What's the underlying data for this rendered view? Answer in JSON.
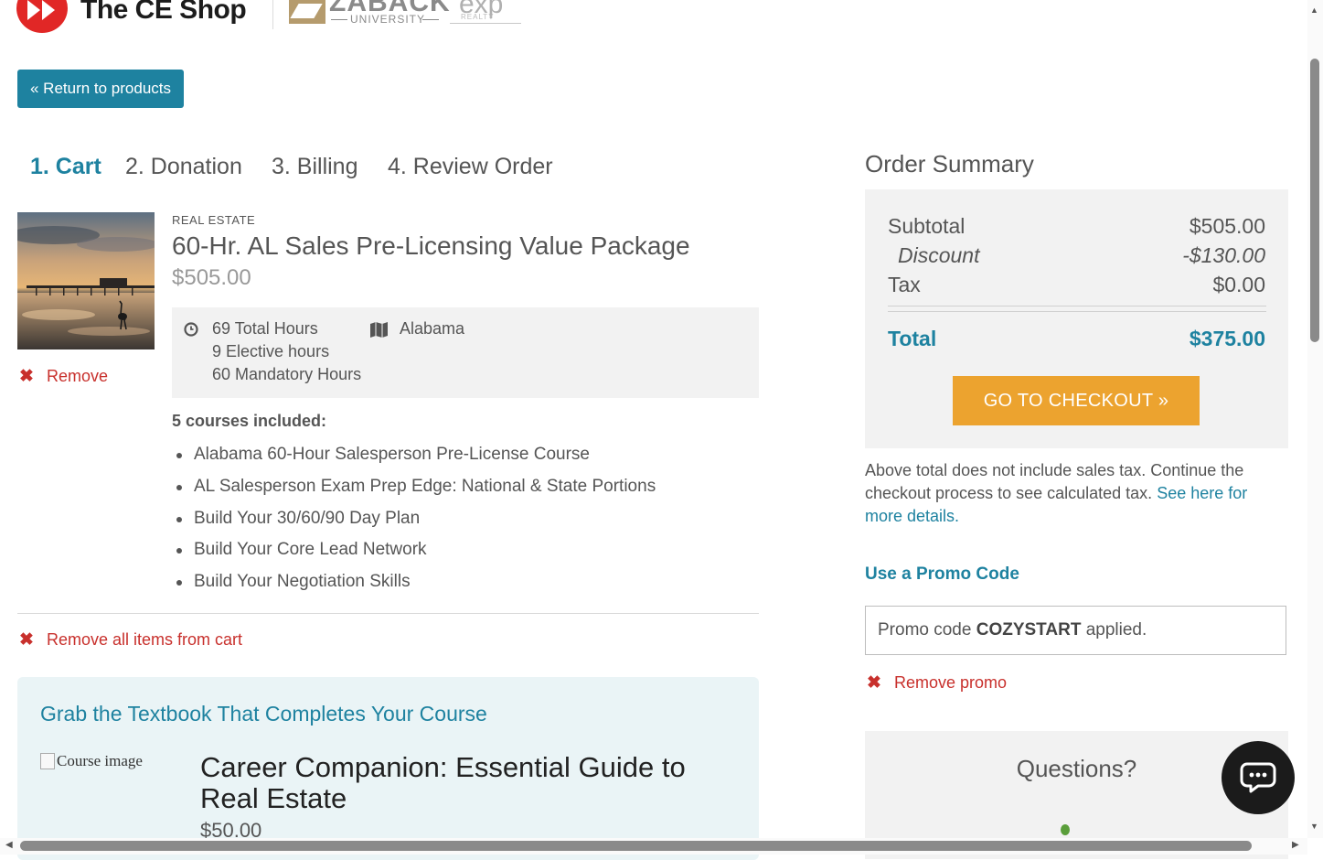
{
  "header": {
    "brand": "The CE Shop",
    "partner1": "ZABACK",
    "partner1_sub": "UNIVERSITY",
    "partner2": "exp",
    "partner2_sub": "REALTY"
  },
  "return_button": "« Return to products",
  "steps": [
    "1. Cart",
    "2. Donation",
    "3. Billing",
    "4. Review Order"
  ],
  "active_step": 0,
  "cart_item": {
    "category": "REAL ESTATE",
    "title": "60-Hr. AL Sales Pre-Licensing Value Package",
    "price": "$505.00",
    "total_hours": "69 Total Hours",
    "elective_hours": "9 Elective hours",
    "mandatory_hours": "60 Mandatory Hours",
    "state": "Alabama",
    "remove_label": "Remove",
    "courses_label": "5 courses included:",
    "courses": [
      "Alabama 60-Hour Salesperson Pre-License Course",
      "AL Salesperson Exam Prep Edge: National & State Portions",
      "Build Your 30/60/90 Day Plan",
      "Build Your Core Lead Network",
      "Build Your Negotiation Skills"
    ]
  },
  "remove_all_label": "Remove all items from cart",
  "upsell": {
    "title": "Grab the Textbook That Completes Your Course",
    "image_alt": "Course image",
    "product_title": "Career Companion: Essential Guide to Real Estate",
    "product_price": "$50.00"
  },
  "order_summary": {
    "title": "Order Summary",
    "subtotal_label": "Subtotal",
    "subtotal_value": "$505.00",
    "discount_label": "Discount",
    "discount_value": "-$130.00",
    "tax_label": "Tax",
    "tax_value": "$0.00",
    "total_label": "Total",
    "total_value": "$375.00",
    "checkout_label": "GO TO CHECKOUT »",
    "tax_note": "Above total does not include sales tax. Continue the checkout process to see calculated tax.",
    "tax_link": "See here for more details."
  },
  "promo": {
    "use_label": "Use a Promo Code",
    "applied_prefix": "Promo code",
    "code": "COZYSTART",
    "applied_suffix": "applied.",
    "remove_label": "Remove promo"
  },
  "questions_title": "Questions?",
  "colors": {
    "accent": "#1e82a0",
    "checkout": "#eca32f",
    "remove": "#c8302c",
    "brand_red": "#e12726"
  }
}
